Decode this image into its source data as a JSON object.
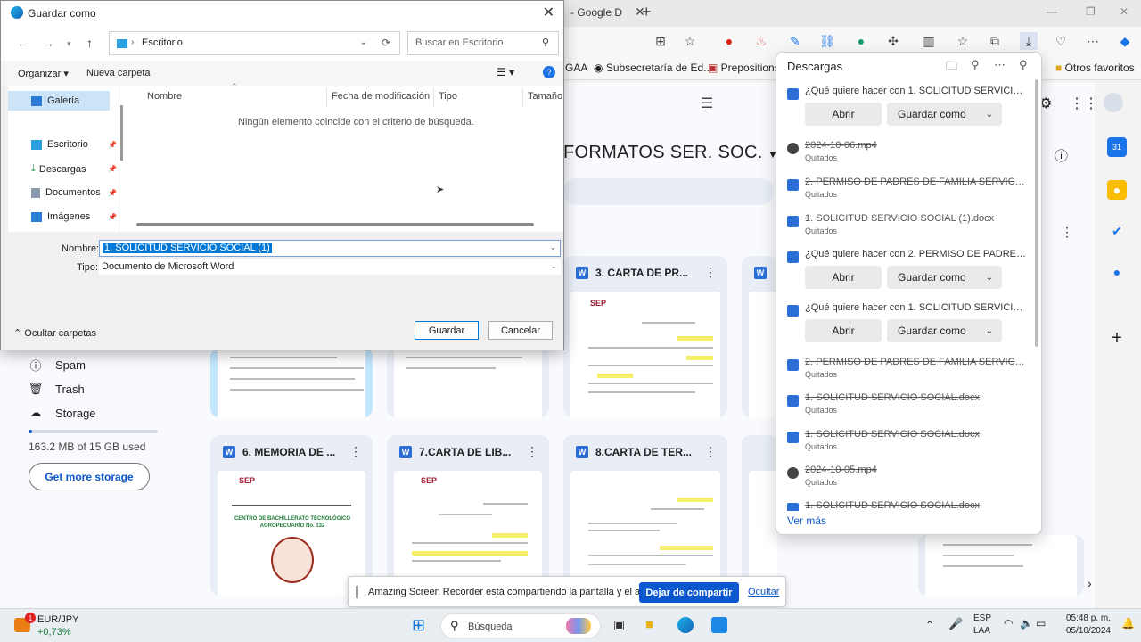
{
  "browser": {
    "tab_title": "- Google D",
    "bookmarks": [
      "GAA",
      "Subsecretaría de Ed...",
      "Prepositions",
      "Otros favoritos"
    ]
  },
  "drive": {
    "folder_title": "FORMATOS SER. SOC.",
    "cards": [
      {
        "label": "3. CARTA DE PR..."
      },
      {
        "label": "6. MEMORIA DE ..."
      },
      {
        "label": "7.CARTA DE LIB..."
      },
      {
        "label": "8.CARTA DE TER..."
      }
    ],
    "nav": {
      "spam": "Spam",
      "trash": "Trash",
      "storage": "Storage"
    },
    "storage_used_text": "163.2 MB of 15 GB used",
    "storage_fraction": 0.011,
    "get_more_storage": "Get more storage",
    "logo_text": "SEP",
    "school_text": "CENTRO DE BACHILLERATO TECNOLÓGICO AGROPECUARIO No. 132"
  },
  "dialog": {
    "title": "Guardar como",
    "address": "Escritorio",
    "search_placeholder": "Buscar en Escritorio",
    "organize": "Organizar ▾",
    "new_folder": "Nueva carpeta",
    "folders": [
      {
        "label": "Galería"
      },
      {
        "label": "Escritorio"
      },
      {
        "label": "Descargas"
      },
      {
        "label": "Documentos"
      },
      {
        "label": "Imágenes"
      }
    ],
    "columns": [
      "Nombre",
      "Fecha de modificación",
      "Tipo",
      "Tamaño"
    ],
    "empty_message": "Ningún elemento coincide con el criterio de búsqueda.",
    "name_label": "Nombre:",
    "name_value": "1. SOLICITUD SERVICIO SOCIAL (1)",
    "type_label": "Tipo:",
    "type_value": "Documento de Microsoft Word",
    "hide_folders": "Ocultar carpetas",
    "save_button": "Guardar",
    "cancel_button": "Cancelar"
  },
  "downloads": {
    "title": "Descargas",
    "items": [
      {
        "name": "¿Qué quiere hacer con 1. SOLICITUD SERVICIO...",
        "type": "prompt",
        "open": "Abrir",
        "save_as": "Guardar como"
      },
      {
        "name": "2024-10-06.mp4",
        "status": "Quitados",
        "type": "removed"
      },
      {
        "name": "2. PERMISO DE PADRES DE FAMILIA SERVICIO SOCIAL...",
        "status": "Quitados",
        "type": "removed"
      },
      {
        "name": "1. SOLICITUD SERVICIO SOCIAL (1).docx",
        "status": "Quitados",
        "type": "removed"
      },
      {
        "name": "¿Qué quiere hacer con 2. PERMISO DE PADRES...",
        "type": "prompt",
        "open": "Abrir",
        "save_as": "Guardar como"
      },
      {
        "name": "¿Qué quiere hacer con 1. SOLICITUD SERVICIO...",
        "type": "prompt",
        "open": "Abrir",
        "save_as": "Guardar como"
      },
      {
        "name": "2. PERMISO DE PADRES DE FAMILIA SERVICIO SOCIAL...",
        "status": "Quitados",
        "type": "removed"
      },
      {
        "name": "1. SOLICITUD SERVICIO SOCIAL.docx",
        "status": "Quitados",
        "type": "removed"
      },
      {
        "name": "1. SOLICITUD SERVICIO SOCIAL.docx",
        "status": "Quitados",
        "type": "removed"
      },
      {
        "name": "2024-10-05.mp4",
        "status": "Quitados",
        "type": "removed"
      },
      {
        "name": "1. SOLICITUD SERVICIO SOCIAL.docx",
        "type": "removed"
      }
    ],
    "see_more": "Ver más"
  },
  "share_bar": {
    "message": "Amazing Screen Recorder está compartiendo la pantalla y el audio.",
    "stop": "Dejar de compartir",
    "hide": "Ocultar"
  },
  "taskbar": {
    "ticker_name": "EUR/JPY",
    "ticker_change": "+0,73%",
    "ticker_badge": "1",
    "search": "Búsqueda",
    "lang_top": "ESP",
    "lang_bottom": "LAA",
    "time": "05:48 p. m.",
    "date": "05/10/2024"
  },
  "colors": {
    "accent": "#0b57d0",
    "word_blue": "#2b6fd6",
    "selection": "#0078d7"
  }
}
